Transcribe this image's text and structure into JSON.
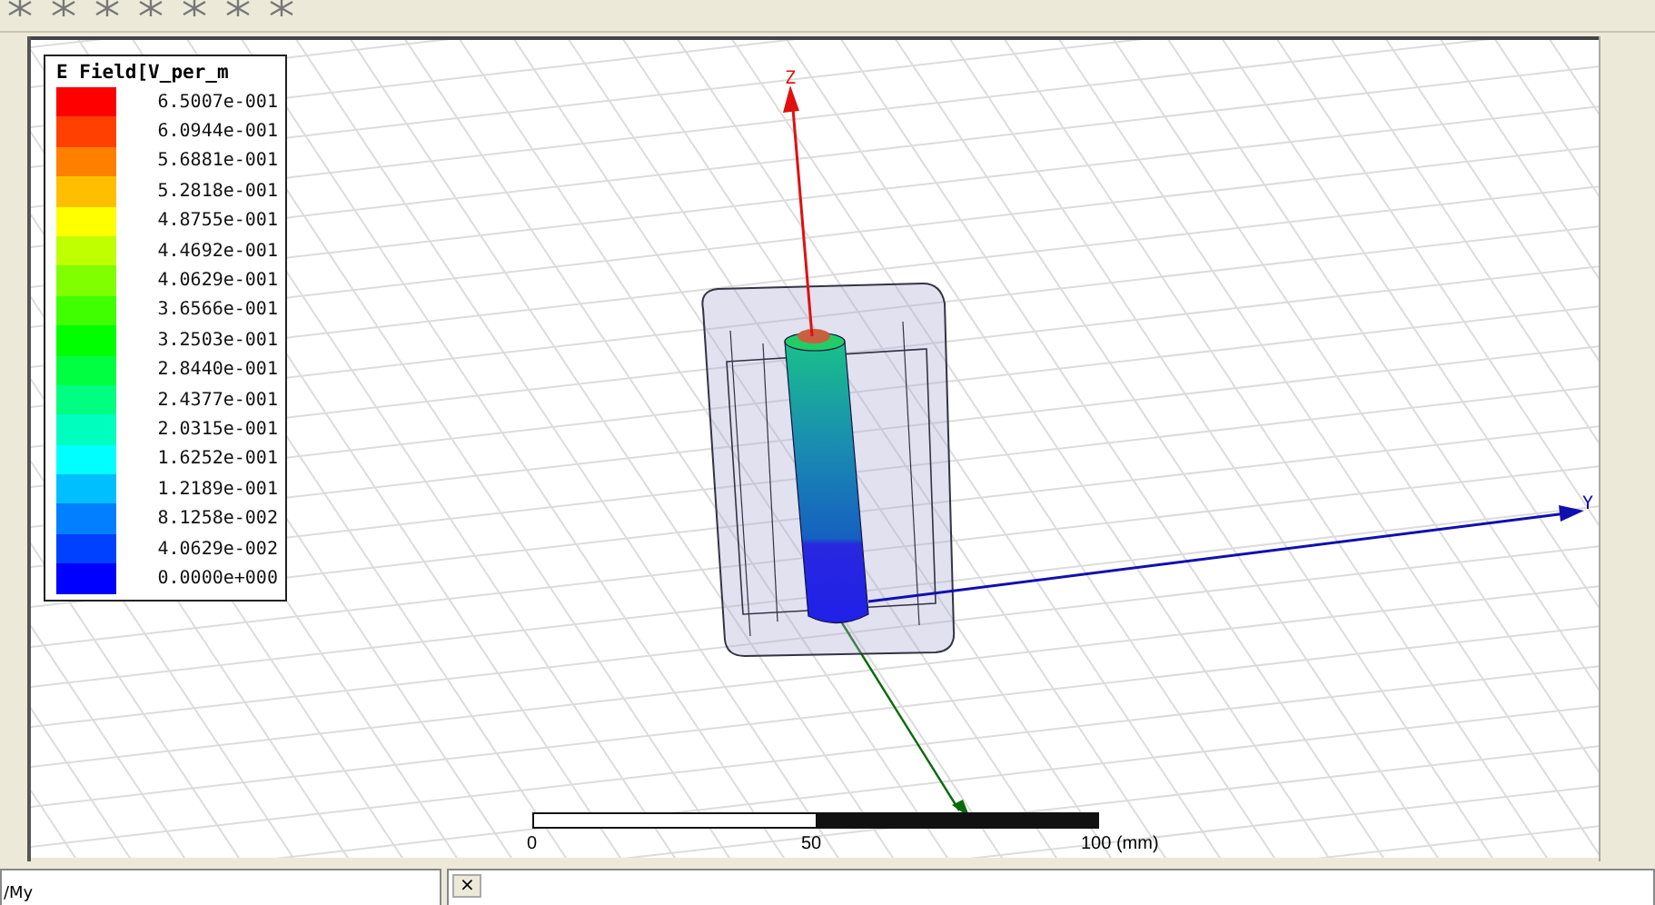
{
  "legend": {
    "title": "E Field[V_per_m",
    "items": [
      {
        "value": "6.5007e-001",
        "color": "#ff0000"
      },
      {
        "value": "6.0944e-001",
        "color": "#ff4000"
      },
      {
        "value": "5.6881e-001",
        "color": "#ff7f00"
      },
      {
        "value": "5.2818e-001",
        "color": "#ffbf00"
      },
      {
        "value": "4.8755e-001",
        "color": "#ffff00"
      },
      {
        "value": "4.4692e-001",
        "color": "#bfff00"
      },
      {
        "value": "4.0629e-001",
        "color": "#7fff00"
      },
      {
        "value": "3.6566e-001",
        "color": "#40ff00"
      },
      {
        "value": "3.2503e-001",
        "color": "#00ff00"
      },
      {
        "value": "2.8440e-001",
        "color": "#00ff40"
      },
      {
        "value": "2.4377e-001",
        "color": "#00ff80"
      },
      {
        "value": "2.0315e-001",
        "color": "#00ffbf"
      },
      {
        "value": "1.6252e-001",
        "color": "#00ffff"
      },
      {
        "value": "1.2189e-001",
        "color": "#00bfff"
      },
      {
        "value": "8.1258e-002",
        "color": "#0080ff"
      },
      {
        "value": "4.0629e-002",
        "color": "#0040ff"
      },
      {
        "value": "0.0000e+000",
        "color": "#0000ff"
      }
    ]
  },
  "axes": {
    "z_label": "Z",
    "y_label": "Y"
  },
  "scale_bar": {
    "labels": [
      "0",
      "50",
      "100 (mm)"
    ]
  },
  "bottom": {
    "left_panel_text": "/My",
    "close_label": "×"
  }
}
